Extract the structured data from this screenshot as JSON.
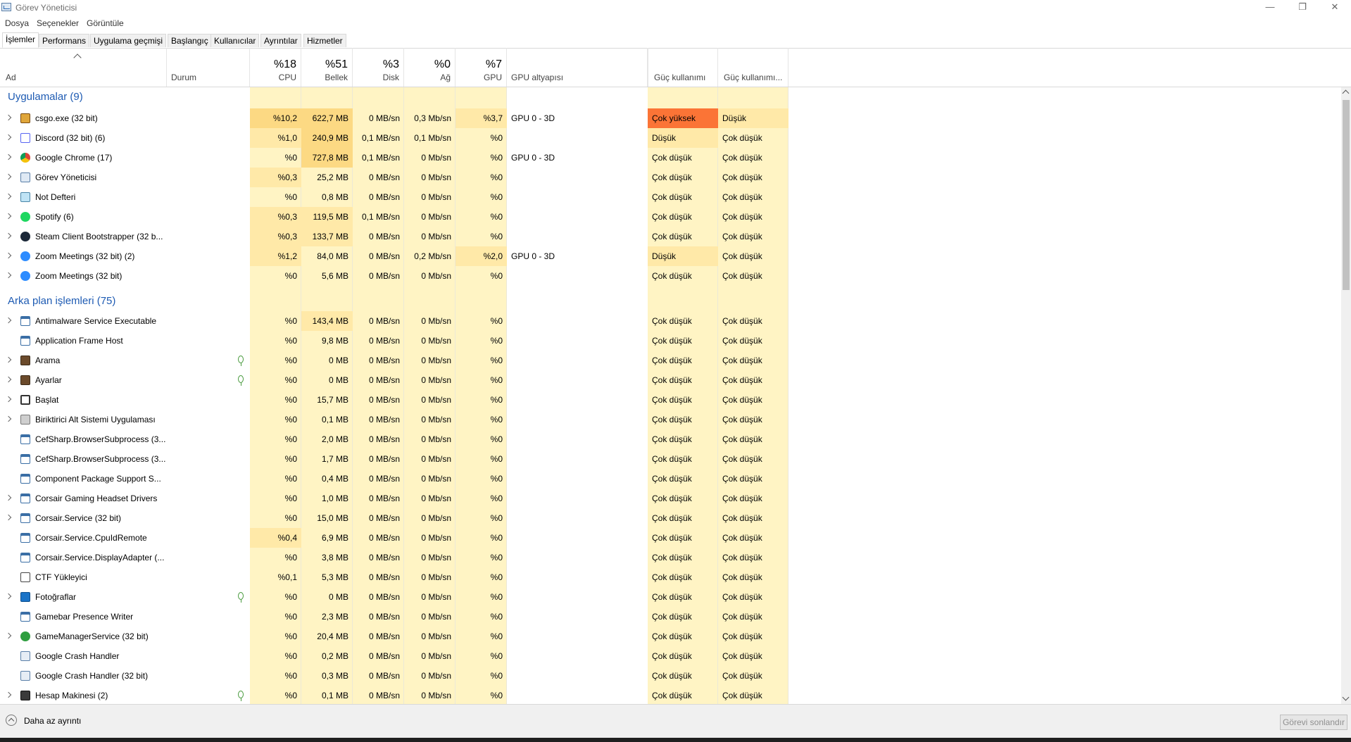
{
  "window": {
    "title": "Görev Yöneticisi",
    "minimize": "—",
    "restore": "❐",
    "close": "✕"
  },
  "menu": [
    "Dosya",
    "Seçenekler",
    "Görüntüle"
  ],
  "tabs": [
    "İşlemler",
    "Performans",
    "Uygulama geçmişi",
    "Başlangıç",
    "Kullanıcılar",
    "Ayrıntılar",
    "Hizmetler"
  ],
  "columns": {
    "name": "Ad",
    "status": "Durum",
    "cpu": {
      "pct": "%18",
      "label": "CPU"
    },
    "memory": {
      "pct": "%51",
      "label": "Bellek"
    },
    "disk": {
      "pct": "%3",
      "label": "Disk"
    },
    "network": {
      "pct": "%0",
      "label": "Ağ"
    },
    "gpu": {
      "pct": "%7",
      "label": "GPU"
    },
    "gpu_engine": "GPU altyapısı",
    "power": "Güç kullanımı",
    "power_trend": "Güç kullanımı..."
  },
  "groups": {
    "apps": "Uygulamalar (9)",
    "background": "Arka plan işlemleri (75)"
  },
  "apps": [
    {
      "name": "csgo.exe (32 bit)",
      "icon": "csgo-icon",
      "expand": true,
      "eco": false,
      "cpu": "%10,2",
      "mem": "622,7 MB",
      "disk": "0 MB/sn",
      "net": "0,3 Mb/sn",
      "gpu": "%3,7",
      "engine": "GPU 0 - 3D",
      "power": "Çok yüksek",
      "trend": "Düşük"
    },
    {
      "name": "Discord (32 bit) (6)",
      "icon": "discord-icon",
      "expand": true,
      "eco": false,
      "cpu": "%1,0",
      "mem": "240,9 MB",
      "disk": "0,1 MB/sn",
      "net": "0,1 Mb/sn",
      "gpu": "%0",
      "engine": "",
      "power": "Düşük",
      "trend": "Çok düşük"
    },
    {
      "name": "Google Chrome (17)",
      "icon": "chrome-icon",
      "expand": true,
      "eco": false,
      "cpu": "%0",
      "mem": "727,8 MB",
      "disk": "0,1 MB/sn",
      "net": "0 Mb/sn",
      "gpu": "%0",
      "engine": "GPU 0 - 3D",
      "power": "Çok düşük",
      "trend": "Çok düşük"
    },
    {
      "name": "Görev Yöneticisi",
      "icon": "task-manager-icon",
      "expand": true,
      "eco": false,
      "cpu": "%0,3",
      "mem": "25,2 MB",
      "disk": "0 MB/sn",
      "net": "0 Mb/sn",
      "gpu": "%0",
      "engine": "",
      "power": "Çok düşük",
      "trend": "Çok düşük"
    },
    {
      "name": "Not Defteri",
      "icon": "notepad-icon",
      "expand": true,
      "eco": false,
      "cpu": "%0",
      "mem": "0,8 MB",
      "disk": "0 MB/sn",
      "net": "0 Mb/sn",
      "gpu": "%0",
      "engine": "",
      "power": "Çok düşük",
      "trend": "Çok düşük"
    },
    {
      "name": "Spotify (6)",
      "icon": "spotify-icon",
      "expand": true,
      "eco": false,
      "cpu": "%0,3",
      "mem": "119,5 MB",
      "disk": "0,1 MB/sn",
      "net": "0 Mb/sn",
      "gpu": "%0",
      "engine": "",
      "power": "Çok düşük",
      "trend": "Çok düşük"
    },
    {
      "name": "Steam Client Bootstrapper (32 b...",
      "icon": "steam-icon",
      "expand": true,
      "eco": false,
      "cpu": "%0,3",
      "mem": "133,7 MB",
      "disk": "0 MB/sn",
      "net": "0 Mb/sn",
      "gpu": "%0",
      "engine": "",
      "power": "Çok düşük",
      "trend": "Çok düşük"
    },
    {
      "name": "Zoom Meetings (32 bit) (2)",
      "icon": "zoom-icon",
      "expand": true,
      "eco": false,
      "cpu": "%1,2",
      "mem": "84,0 MB",
      "disk": "0 MB/sn",
      "net": "0,2 Mb/sn",
      "gpu": "%2,0",
      "engine": "GPU 0 - 3D",
      "power": "Düşük",
      "trend": "Çok düşük"
    },
    {
      "name": "Zoom Meetings (32 bit)",
      "icon": "zoom-icon",
      "expand": true,
      "eco": false,
      "cpu": "%0",
      "mem": "5,6 MB",
      "disk": "0 MB/sn",
      "net": "0 Mb/sn",
      "gpu": "%0",
      "engine": "",
      "power": "Çok düşük",
      "trend": "Çok düşük"
    }
  ],
  "background": [
    {
      "name": "Antimalware Service Executable",
      "icon": "service-icon",
      "expand": true,
      "eco": false,
      "cpu": "%0",
      "mem": "143,4 MB",
      "disk": "0 MB/sn",
      "net": "0 Mb/sn",
      "gpu": "%0",
      "engine": "",
      "power": "Çok düşük",
      "trend": "Çok düşük"
    },
    {
      "name": "Application Frame Host",
      "icon": "service-icon",
      "expand": false,
      "eco": false,
      "cpu": "%0",
      "mem": "9,8 MB",
      "disk": "0 MB/sn",
      "net": "0 Mb/sn",
      "gpu": "%0",
      "engine": "",
      "power": "Çok düşük",
      "trend": "Çok düşük"
    },
    {
      "name": "Arama",
      "icon": "search-icon",
      "expand": true,
      "eco": true,
      "cpu": "%0",
      "mem": "0 MB",
      "disk": "0 MB/sn",
      "net": "0 Mb/sn",
      "gpu": "%0",
      "engine": "",
      "power": "Çok düşük",
      "trend": "Çok düşük"
    },
    {
      "name": "Ayarlar",
      "icon": "settings-icon",
      "expand": true,
      "eco": true,
      "cpu": "%0",
      "mem": "0 MB",
      "disk": "0 MB/sn",
      "net": "0 Mb/sn",
      "gpu": "%0",
      "engine": "",
      "power": "Çok düşük",
      "trend": "Çok düşük"
    },
    {
      "name": "Başlat",
      "icon": "start-icon",
      "expand": true,
      "eco": false,
      "cpu": "%0",
      "mem": "15,7 MB",
      "disk": "0 MB/sn",
      "net": "0 Mb/sn",
      "gpu": "%0",
      "engine": "",
      "power": "Çok düşük",
      "trend": "Çok düşük"
    },
    {
      "name": "Biriktirici Alt Sistemi Uygulaması",
      "icon": "printer-icon",
      "expand": true,
      "eco": false,
      "cpu": "%0",
      "mem": "0,1 MB",
      "disk": "0 MB/sn",
      "net": "0 Mb/sn",
      "gpu": "%0",
      "engine": "",
      "power": "Çok düşük",
      "trend": "Çok düşük"
    },
    {
      "name": "CefSharp.BrowserSubprocess (3...",
      "icon": "service-icon",
      "expand": false,
      "eco": false,
      "cpu": "%0",
      "mem": "2,0 MB",
      "disk": "0 MB/sn",
      "net": "0 Mb/sn",
      "gpu": "%0",
      "engine": "",
      "power": "Çok düşük",
      "trend": "Çok düşük"
    },
    {
      "name": "CefSharp.BrowserSubprocess (3...",
      "icon": "service-icon",
      "expand": false,
      "eco": false,
      "cpu": "%0",
      "mem": "1,7 MB",
      "disk": "0 MB/sn",
      "net": "0 Mb/sn",
      "gpu": "%0",
      "engine": "",
      "power": "Çok düşük",
      "trend": "Çok düşük"
    },
    {
      "name": "Component Package Support S...",
      "icon": "service-icon",
      "expand": false,
      "eco": false,
      "cpu": "%0",
      "mem": "0,4 MB",
      "disk": "0 MB/sn",
      "net": "0 Mb/sn",
      "gpu": "%0",
      "engine": "",
      "power": "Çok düşük",
      "trend": "Çok düşük"
    },
    {
      "name": "Corsair Gaming Headset Drivers",
      "icon": "service-icon",
      "expand": true,
      "eco": false,
      "cpu": "%0",
      "mem": "1,0 MB",
      "disk": "0 MB/sn",
      "net": "0 Mb/sn",
      "gpu": "%0",
      "engine": "",
      "power": "Çok düşük",
      "trend": "Çok düşük"
    },
    {
      "name": "Corsair.Service (32 bit)",
      "icon": "service-icon",
      "expand": true,
      "eco": false,
      "cpu": "%0",
      "mem": "15,0 MB",
      "disk": "0 MB/sn",
      "net": "0 Mb/sn",
      "gpu": "%0",
      "engine": "",
      "power": "Çok düşük",
      "trend": "Çok düşük"
    },
    {
      "name": "Corsair.Service.CpuIdRemote",
      "icon": "service-icon",
      "expand": false,
      "eco": false,
      "cpu": "%0,4",
      "mem": "6,9 MB",
      "disk": "0 MB/sn",
      "net": "0 Mb/sn",
      "gpu": "%0",
      "engine": "",
      "power": "Çok düşük",
      "trend": "Çok düşük"
    },
    {
      "name": "Corsair.Service.DisplayAdapter (...",
      "icon": "service-icon",
      "expand": false,
      "eco": false,
      "cpu": "%0",
      "mem": "3,8 MB",
      "disk": "0 MB/sn",
      "net": "0 Mb/sn",
      "gpu": "%0",
      "engine": "",
      "power": "Çok düşük",
      "trend": "Çok düşük"
    },
    {
      "name": "CTF Yükleyici",
      "icon": "ctf-icon",
      "expand": false,
      "eco": false,
      "cpu": "%0,1",
      "mem": "5,3 MB",
      "disk": "0 MB/sn",
      "net": "0 Mb/sn",
      "gpu": "%0",
      "engine": "",
      "power": "Çok düşük",
      "trend": "Çok düşük"
    },
    {
      "name": "Fotoğraflar",
      "icon": "photos-icon",
      "expand": true,
      "eco": true,
      "cpu": "%0",
      "mem": "0 MB",
      "disk": "0 MB/sn",
      "net": "0 Mb/sn",
      "gpu": "%0",
      "engine": "",
      "power": "Çok düşük",
      "trend": "Çok düşük"
    },
    {
      "name": "Gamebar Presence Writer",
      "icon": "service-icon",
      "expand": false,
      "eco": false,
      "cpu": "%0",
      "mem": "2,3 MB",
      "disk": "0 MB/sn",
      "net": "0 Mb/sn",
      "gpu": "%0",
      "engine": "",
      "power": "Çok düşük",
      "trend": "Çok düşük"
    },
    {
      "name": "GameManagerService (32 bit)",
      "icon": "gamemanager-icon",
      "expand": true,
      "eco": false,
      "cpu": "%0",
      "mem": "20,4 MB",
      "disk": "0 MB/sn",
      "net": "0 Mb/sn",
      "gpu": "%0",
      "engine": "",
      "power": "Çok düşük",
      "trend": "Çok düşük"
    },
    {
      "name": "Google Crash Handler",
      "icon": "crash-handler-icon",
      "expand": false,
      "eco": false,
      "cpu": "%0",
      "mem": "0,2 MB",
      "disk": "0 MB/sn",
      "net": "0 Mb/sn",
      "gpu": "%0",
      "engine": "",
      "power": "Çok düşük",
      "trend": "Çok düşük"
    },
    {
      "name": "Google Crash Handler (32 bit)",
      "icon": "crash-handler-icon",
      "expand": false,
      "eco": false,
      "cpu": "%0",
      "mem": "0,3 MB",
      "disk": "0 MB/sn",
      "net": "0 Mb/sn",
      "gpu": "%0",
      "engine": "",
      "power": "Çok düşük",
      "trend": "Çok düşük"
    },
    {
      "name": "Hesap Makinesi (2)",
      "icon": "calculator-icon",
      "expand": true,
      "eco": true,
      "cpu": "%0",
      "mem": "0,1 MB",
      "disk": "0 MB/sn",
      "net": "0 Mb/sn",
      "gpu": "%0",
      "engine": "",
      "power": "Çok düşük",
      "trend": "Çok düşük"
    }
  ],
  "footer": {
    "fewer_details": "Daha az ayrıntı",
    "end_task": "Görevi sonlandır"
  },
  "colors": {
    "heat_low": "#fff4c4",
    "heat_mid": "#ffe9a8",
    "heat_high": "#fcd983",
    "power_very_high": "#fb7436",
    "group_title": "#1e5bb3"
  }
}
